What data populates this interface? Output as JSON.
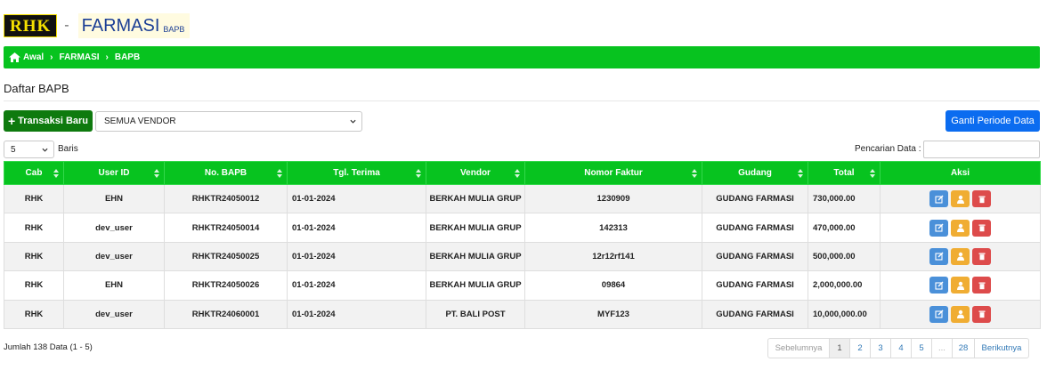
{
  "header": {
    "logo": "RHK",
    "dash": "-",
    "title": "FARMASI",
    "subtitle": "BAPB"
  },
  "breadcrumb": [
    "Awal",
    "FARMASI",
    "BAPB"
  ],
  "section_title": "Daftar BAPB",
  "toolbar": {
    "new_label": "Transaksi Baru",
    "vendor_value": "SEMUA VENDOR",
    "periode_label": "Ganti Periode Data"
  },
  "list_controls": {
    "rows_value": "5",
    "rows_label": "Baris",
    "search_label": "Pencarian Data :",
    "search_value": ""
  },
  "table": {
    "columns": [
      "Cab",
      "User ID",
      "No. BAPB",
      "Tgl. Terima",
      "Vendor",
      "Nomor Faktur",
      "Gudang",
      "Total",
      "Aksi"
    ],
    "rows": [
      [
        "RHK",
        "EHN",
        "RHKTR24050012",
        "01-01-2024",
        "BERKAH MULIA GRUP",
        "1230909",
        "GUDANG FARMASI",
        "730,000.00"
      ],
      [
        "RHK",
        "dev_user",
        "RHKTR24050014",
        "01-01-2024",
        "BERKAH MULIA GRUP",
        "142313",
        "GUDANG FARMASI",
        "470,000.00"
      ],
      [
        "RHK",
        "dev_user",
        "RHKTR24050025",
        "01-01-2024",
        "BERKAH MULIA GRUP",
        "12r12rf141",
        "GUDANG FARMASI",
        "500,000.00"
      ],
      [
        "RHK",
        "EHN",
        "RHKTR24050026",
        "01-01-2024",
        "BERKAH MULIA GRUP",
        "09864",
        "GUDANG FARMASI",
        "2,000,000.00"
      ],
      [
        "RHK",
        "dev_user",
        "RHKTR24060001",
        "01-01-2024",
        "PT. BALI POST",
        "MYF123",
        "GUDANG FARMASI",
        "10,000,000.00"
      ]
    ]
  },
  "footer": {
    "info": "Jumlah 138 Data (1 - 5)",
    "pagination": [
      "Sebelumnya",
      "1",
      "2",
      "3",
      "4",
      "5",
      "...",
      "28",
      "Berikutnya"
    ],
    "active_page": "1"
  },
  "colors": {
    "brand_green": "#07c31f",
    "new_button": "#0e7a0e",
    "periode_button": "#0b6cf0",
    "edit": "#4a90d9",
    "print": "#f0ad33",
    "delete": "#dd4b4b"
  },
  "icons": [
    "home-icon",
    "chevron-right-icon",
    "plus-icon",
    "chevron-down-icon",
    "sort-icon",
    "edit-icon",
    "print-icon",
    "trash-icon"
  ]
}
